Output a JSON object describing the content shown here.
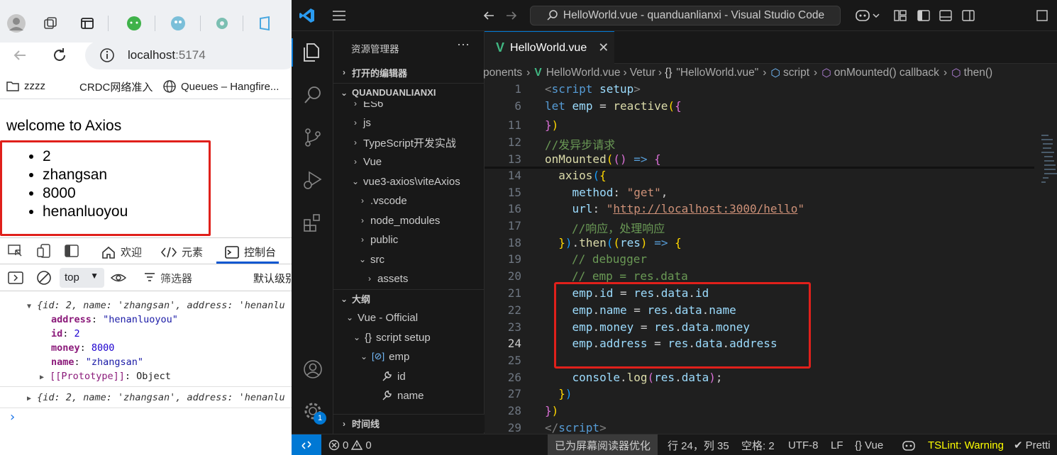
{
  "browser": {
    "url_host": "localhost",
    "url_port": ":5174",
    "bookmarks": [
      "zzzz",
      "CRDC网络准入",
      "Queues – Hangfire..."
    ],
    "page": {
      "heading": "welcome to Axios",
      "list": [
        "2",
        "zhangsan",
        "8000",
        "henanluoyou"
      ]
    },
    "devtools": {
      "tabs": [
        "欢迎",
        "元素",
        "控制台"
      ],
      "active_tab": "控制台",
      "context": "top",
      "filter_label": "筛选器",
      "level_label": "默认级别",
      "console": {
        "summary1": "{id: 2, name: 'zhangsan', address: 'henanlu",
        "props": [
          {
            "key": "address",
            "value": "\"henanluoyou\""
          },
          {
            "key": "id",
            "value": "2"
          },
          {
            "key": "money",
            "value": "8000"
          },
          {
            "key": "name",
            "value": "\"zhangsan\""
          }
        ],
        "prototype_key": "[[Prototype]]",
        "prototype_value": "Object",
        "summary2": "{id: 2, name: 'zhangsan', address: 'henanlu",
        "prompt": "›"
      }
    }
  },
  "vscode": {
    "title": "HelloWorld.vue - quanduanlianxi - Visual Studio Code",
    "explorer_title": "资源管理器",
    "open_editors": "打开的编辑器",
    "project": "QUANDUANLIANXI",
    "tree": [
      "ES6",
      "js",
      "TypeScript开发实战",
      "Vue",
      "vue3-axios\\viteAxios",
      ".vscode",
      "node_modules",
      "public",
      "src",
      "assets"
    ],
    "outline_title": "大纲",
    "outline": [
      "Vue - Official",
      "script setup",
      "emp",
      "id",
      "name"
    ],
    "timeline": "时间线",
    "tab": "HelloWorld.vue",
    "breadcrumb": [
      "ponents",
      "HelloWorld.vue",
      "Vetur",
      "\"HelloWorld.vue\"",
      "script",
      "onMounted() callback",
      "then()"
    ],
    "line_numbers": [
      "1",
      "6",
      "11",
      "12",
      "13",
      "14",
      "15",
      "16",
      "17",
      "18",
      "19",
      "20",
      "21",
      "22",
      "23",
      "24",
      "25",
      "26",
      "27",
      "28",
      "29"
    ],
    "comment_async": "//发异步请求",
    "comment_response": "//响应，处理响应",
    "comment_debugger": "// debugger",
    "comment_emp": "// emp = res.data",
    "url_string": "http://localhost:3000/hello",
    "status": {
      "errors": "0",
      "warnings": "0",
      "screen_reader": "已为屏幕阅读器优化",
      "position": "行 24，列 35",
      "spaces": "空格: 2",
      "encoding": "UTF-8",
      "eol": "LF",
      "language": "Vue",
      "tslint": "TSLint: Warning",
      "prettier": "Pretti",
      "badge": "1"
    },
    "colors": {
      "accent": "#0078d4",
      "status_warning": "#ffff00",
      "highlight_box": "#e0201b"
    }
  }
}
